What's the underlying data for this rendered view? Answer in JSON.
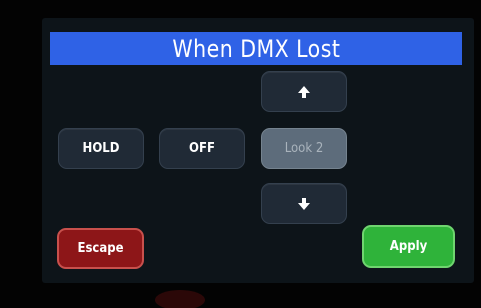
{
  "header": {
    "title": "When DMX Lost"
  },
  "options": {
    "hold_label": "HOLD",
    "off_label": "OFF",
    "look_label": "Look 2"
  },
  "look_selector": {
    "up_icon": "arrow-up-icon",
    "down_icon": "arrow-down-icon"
  },
  "footer": {
    "escape_label": "Escape",
    "apply_label": "Apply"
  },
  "colors": {
    "title_bar": "#2f62e6",
    "escape": "#8d1618",
    "apply": "#2fb33a",
    "selected": "#5d6c7b"
  }
}
